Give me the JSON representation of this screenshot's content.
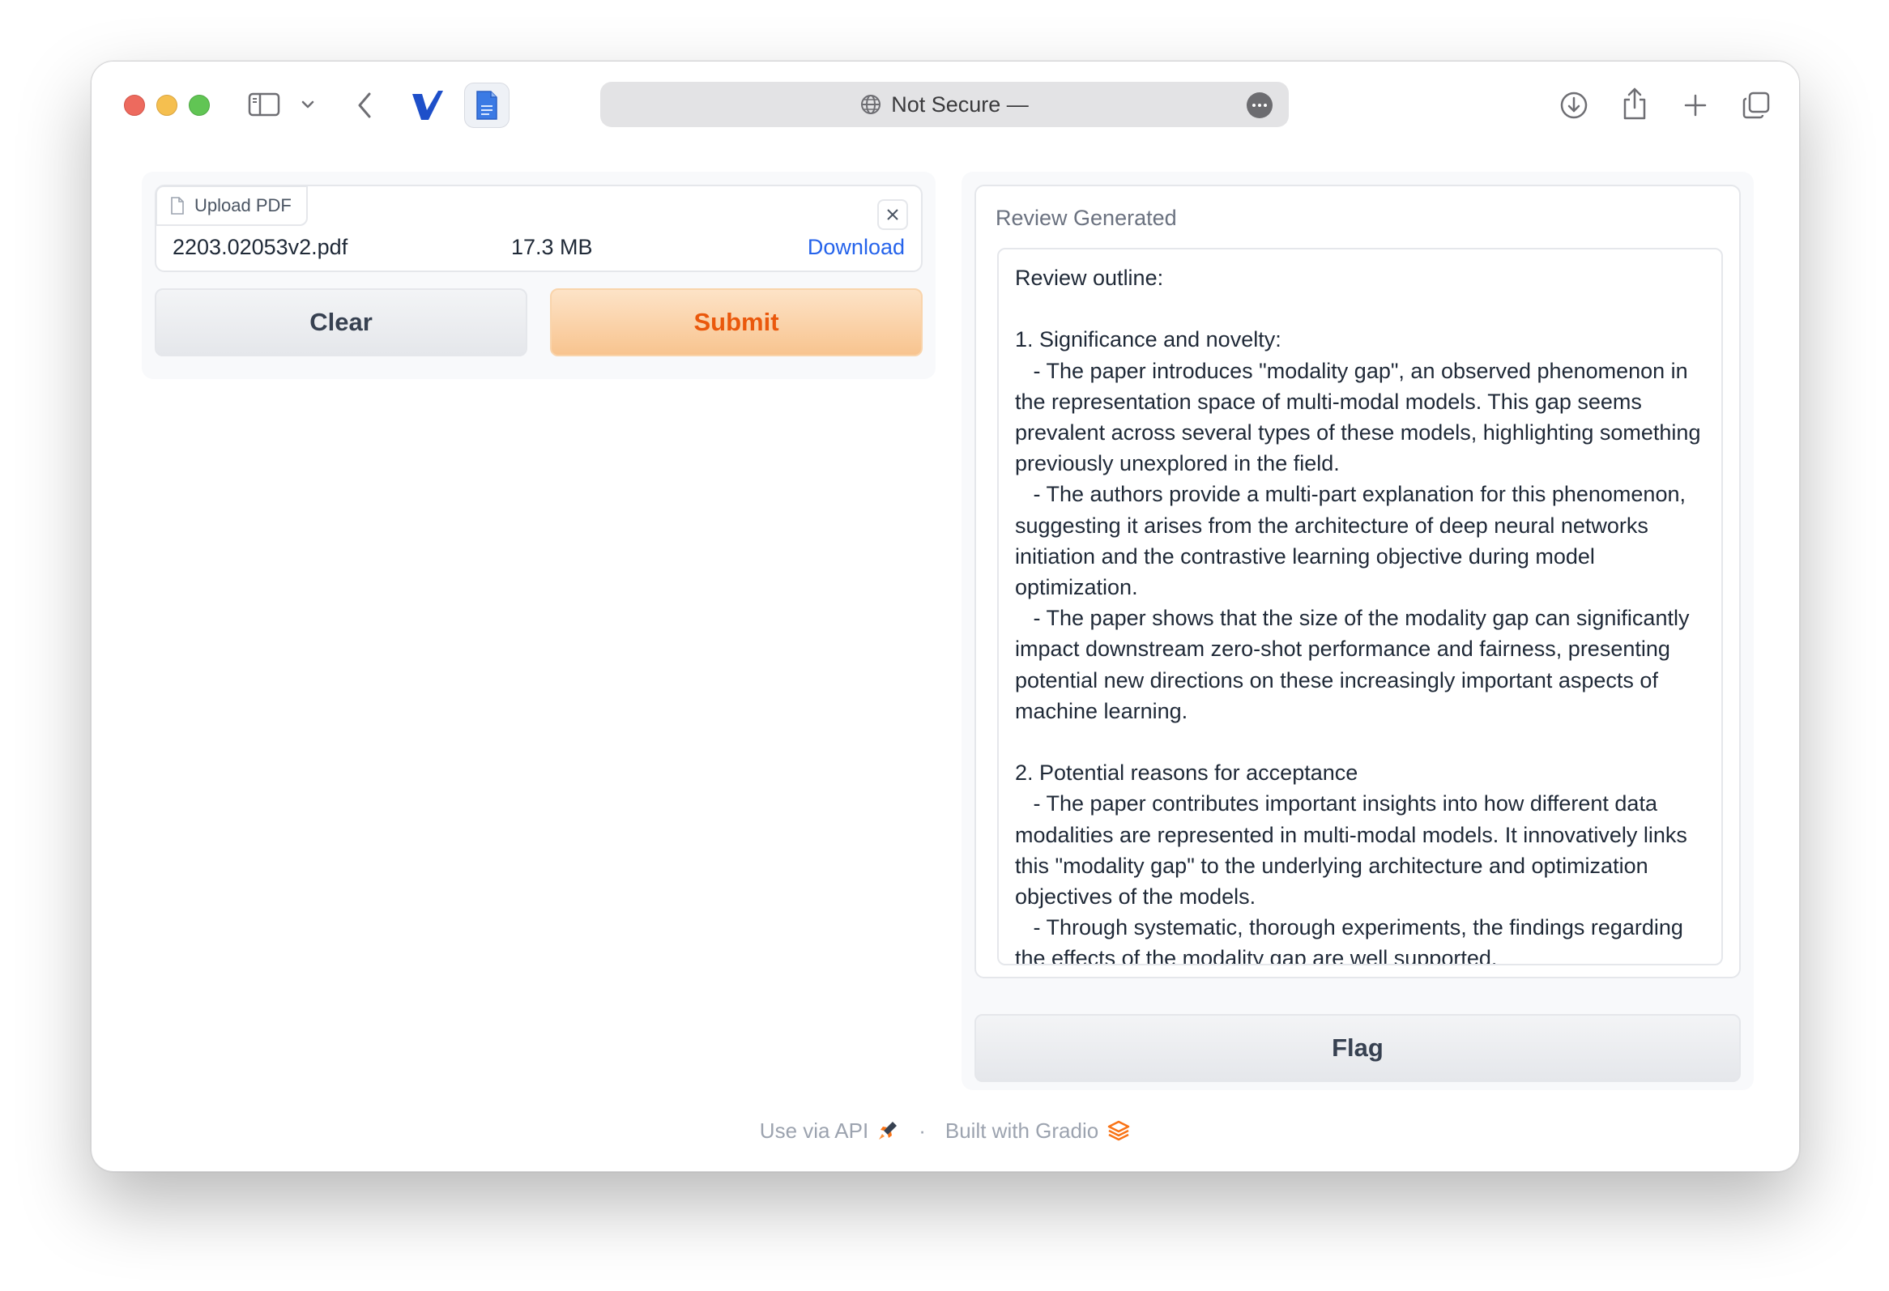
{
  "browser": {
    "url_text": "Not Secure —"
  },
  "upload": {
    "label": "Upload PDF",
    "file_name": "2203.02053v2.pdf",
    "file_size": "17.3 MB",
    "download_label": "Download"
  },
  "buttons": {
    "clear": "Clear",
    "submit": "Submit",
    "flag": "Flag"
  },
  "review": {
    "label": "Review Generated",
    "text": "Review outline:\n\n1. Significance and novelty:\n   - The paper introduces \"modality gap\", an observed phenomenon in the representation space of multi-modal models. This gap seems prevalent across several types of these models, highlighting something previously unexplored in the field.\n   - The authors provide a multi-part explanation for this phenomenon, suggesting it arises from the architecture of deep neural networks initiation and the contrastive learning objective during model optimization.\n   - The paper shows that the size of the modality gap can significantly impact downstream zero-shot performance and fairness, presenting potential new directions on these increasingly important aspects of machine learning.\n\n2. Potential reasons for acceptance\n   - The paper contributes important insights into how different data modalities are represented in multi-modal models. It innovatively links this \"modality gap\" to the underlying architecture and optimization objectives of the models.\n   - Through systematic, thorough experiments, the findings regarding the effects of the modality gap are well supported."
  },
  "footer": {
    "api_text": "Use via API",
    "separator": "·",
    "built_text": "Built with Gradio"
  },
  "colors": {
    "accent_orange": "#ea580c",
    "link_blue": "#2563eb"
  },
  "icons": [
    "sidebar-icon",
    "chevron-down-icon",
    "back-icon",
    "v-logo-icon",
    "document-icon",
    "globe-icon",
    "more-icon",
    "download-icon",
    "share-icon",
    "plus-icon",
    "tabs-icon",
    "file-icon",
    "close-icon",
    "rocket-icon",
    "gradio-logo-icon"
  ]
}
